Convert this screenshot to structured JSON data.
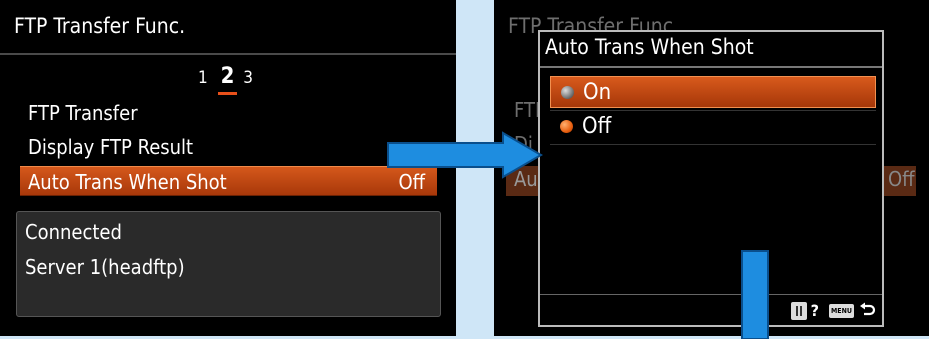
{
  "left_screen": {
    "title": "FTP Transfer Func.",
    "pages": [
      "1",
      "2",
      "3"
    ],
    "current_page": "2",
    "menu_items": [
      {
        "label": "FTP Transfer",
        "value": ""
      },
      {
        "label": "Display FTP Result",
        "value": ""
      },
      {
        "label": "Auto Trans When Shot",
        "value": "Off"
      }
    ],
    "status_lines": [
      "Connected",
      "Server 1(headftp)"
    ]
  },
  "right_screen": {
    "background_title": "FTP Transfer Func.",
    "background_item_prefix_1": "FTP",
    "background_item_prefix_2": "Di",
    "background_item_prefix_3": "Au",
    "background_value": "Off",
    "dialog": {
      "title": "Auto Trans When Shot",
      "options": [
        {
          "label": "On",
          "selected": true
        },
        {
          "label": "Off",
          "selected": false
        }
      ],
      "help_label": "?",
      "menu_key_label": "MENU"
    }
  },
  "colors": {
    "accent_orange": "#c94a12",
    "arrow_blue": "#1e8de0",
    "page_background": "#cfe6f7"
  }
}
